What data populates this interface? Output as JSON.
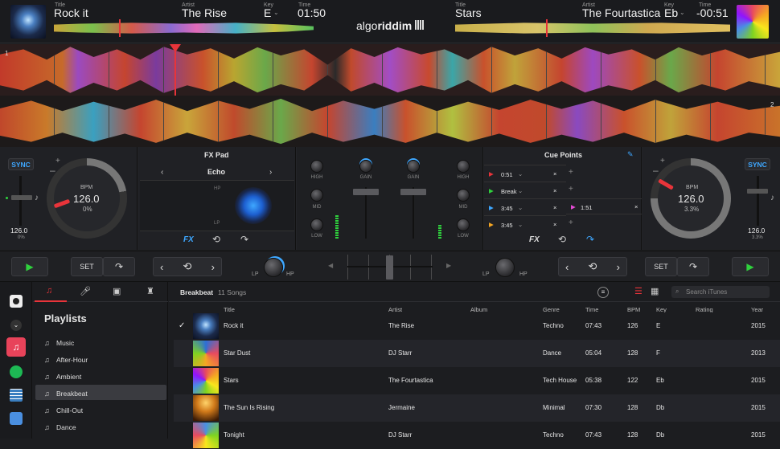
{
  "deck_left": {
    "title_label": "Title",
    "title": "Rock it",
    "artist_label": "Artist",
    "artist": "The Rise",
    "key_label": "Key",
    "key": "E",
    "time_label": "Time",
    "time": "01:50",
    "bpm_label": "BPM",
    "bpm": "126.0",
    "pitch": "0%",
    "sync": "SYNC",
    "tempo": "126.0",
    "tempo_pct": "0%",
    "deck_number": "1"
  },
  "deck_right": {
    "title_label": "Title",
    "title": "Stars",
    "artist_label": "Artist",
    "artist": "The Fourtastica",
    "key_label": "Key",
    "key": "Eb",
    "time_label": "Time",
    "time": "-00:51",
    "bpm_label": "BPM",
    "bpm": "126.0",
    "pitch": "3.3%",
    "sync": "SYNC",
    "tempo": "126.0",
    "tempo_pct": "3.3%",
    "deck_number": "2"
  },
  "logo": {
    "text_light": "algo",
    "text_bold": "riddim"
  },
  "fx": {
    "header": "FX Pad",
    "effect": "Echo",
    "hp": "HP",
    "lp": "LP",
    "fx_label": "FX"
  },
  "mixer": {
    "high": "HIGH",
    "mid": "MID",
    "low": "LOW",
    "gain": "GAIN",
    "lp": "LP",
    "hp": "HP"
  },
  "cue": {
    "header": "Cue Points",
    "points": [
      {
        "time": "0:51",
        "color": "#e8343a"
      },
      {
        "time": "Break",
        "color": "#2fd13d"
      },
      {
        "time": "3:45",
        "color": "#3ea7ff"
      },
      {
        "time": "3:45",
        "color": "#f5a623"
      }
    ],
    "extra": {
      "time": "1:51",
      "color": "#e64bd6"
    },
    "fx_label": "FX"
  },
  "transport": {
    "set": "SET"
  },
  "library": {
    "playlists_title": "Playlists",
    "playlists": [
      "Music",
      "After-Hour",
      "Ambient",
      "Breakbeat",
      "Chill-Out",
      "Dance"
    ],
    "selected_playlist": "Breakbeat",
    "crate_title": "Breakbeat",
    "song_count": "11 Songs",
    "search_placeholder": "Search iTunes",
    "columns": [
      "Title",
      "Artist",
      "Album",
      "Genre",
      "Time",
      "BPM",
      "Key",
      "Rating",
      "Year"
    ],
    "tracks": [
      {
        "title": "Rock it",
        "artist": "The Rise",
        "album": "",
        "genre": "Techno",
        "time": "07:43",
        "bpm": "126",
        "key": "E",
        "year": "2015"
      },
      {
        "title": "Star Dust",
        "artist": "DJ Starr",
        "album": "",
        "genre": "Dance",
        "time": "05:04",
        "bpm": "128",
        "key": "F",
        "year": "2013"
      },
      {
        "title": "Stars",
        "artist": "The Fourtastica",
        "album": "",
        "genre": "Tech House",
        "time": "05:38",
        "bpm": "122",
        "key": "Eb",
        "year": "2015"
      },
      {
        "title": "The Sun Is Rising",
        "artist": "Jermaine",
        "album": "",
        "genre": "Minimal",
        "time": "07:30",
        "bpm": "128",
        "key": "Db",
        "year": "2015"
      },
      {
        "title": "Tonight",
        "artist": "DJ Starr",
        "album": "",
        "genre": "Techno",
        "time": "07:43",
        "bpm": "128",
        "key": "Db",
        "year": "2015"
      }
    ]
  },
  "colors": {
    "accent_red": "#e8343a",
    "accent_blue": "#3ea7ff",
    "play_green": "#2fd13d"
  }
}
